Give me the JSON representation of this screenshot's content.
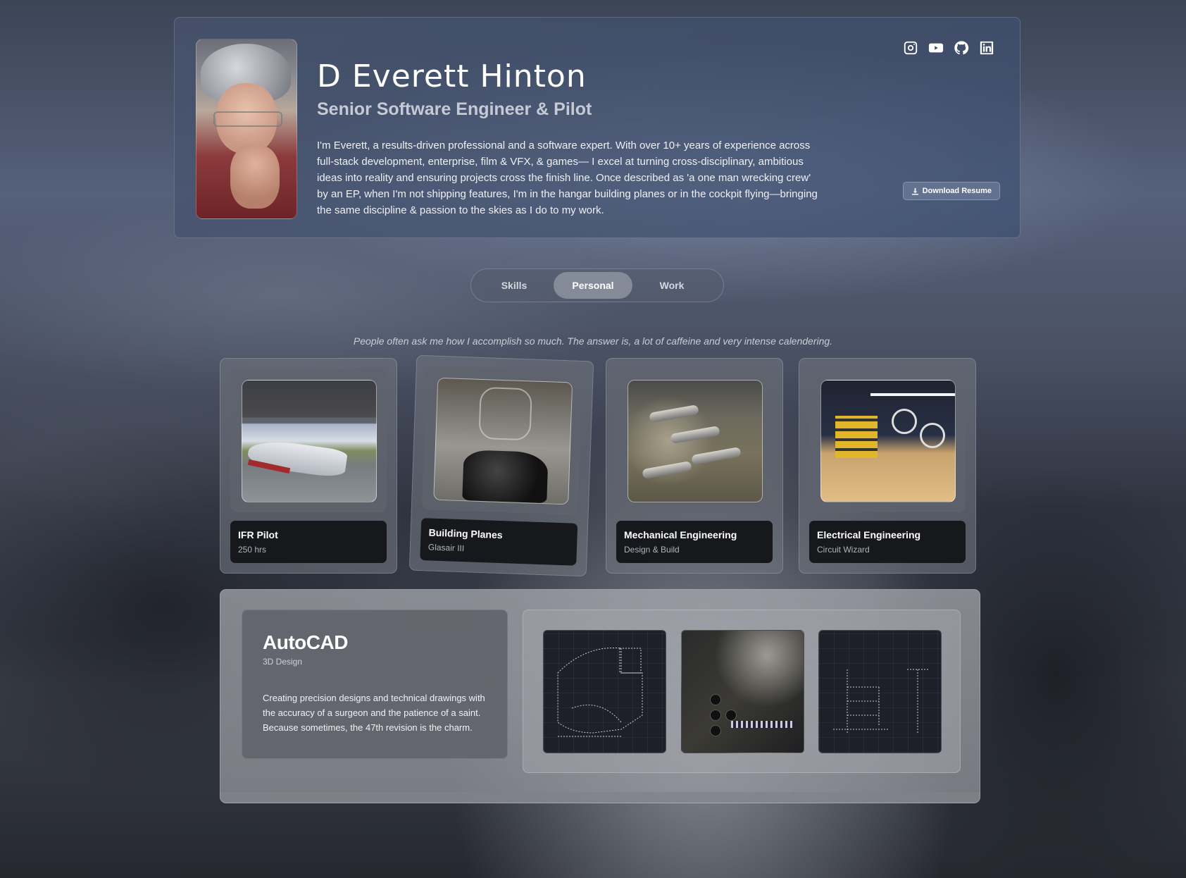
{
  "profile": {
    "name": "D Everett Hinton",
    "title": "Senior Software Engineer & Pilot",
    "bio": "I'm Everett, a results-driven professional and a software expert. With over 10+ years of experience across full-stack development, enterprise, film & VFX, & games— I excel at turning cross-disciplinary, ambitious ideas into reality and ensuring projects cross the finish line. Once described as 'a one man wrecking crew' by an EP, when I'm not shipping features, I'm in the hangar building planes or in the cockpit flying—bringing the same discipline & passion to the skies as I do to my work.",
    "resume_label": "Download Resume",
    "socials": [
      "instagram-icon",
      "youtube-icon",
      "github-icon",
      "linkedin-icon"
    ]
  },
  "tabs": [
    {
      "label": "Skills",
      "active": false
    },
    {
      "label": "Personal",
      "active": true
    },
    {
      "label": "Work",
      "active": false
    }
  ],
  "quote": "People often ask me how I accomplish so much. The answer is, a lot of caffeine and very intense calendering.",
  "cards": [
    {
      "title": "IFR Pilot",
      "subtitle": "250 hrs"
    },
    {
      "title": "Building Planes",
      "subtitle": "Glasair III"
    },
    {
      "title": "Mechanical Engineering",
      "subtitle": "Design & Build"
    },
    {
      "title": "Electrical Engineering",
      "subtitle": "Circuit Wizard"
    }
  ],
  "featured": {
    "title": "AutoCAD",
    "subtitle": "3D Design",
    "description": "Creating precision designs and technical drawings with the accuracy of a surgeon and the patience of a saint. Because sometimes, the 47th revision is the charm."
  },
  "colors": {
    "hero_bg": "#46557a",
    "caption_bg": "#17181c",
    "active_tab": "#91969f"
  }
}
